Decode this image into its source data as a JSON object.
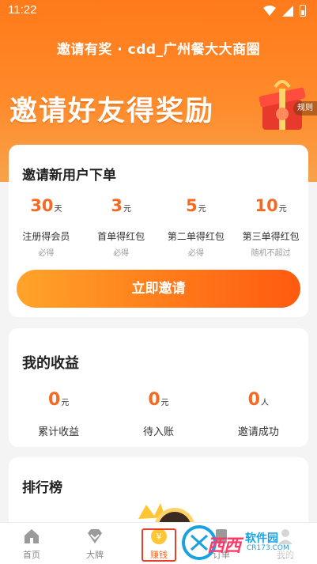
{
  "status_bar": {
    "time": "11:22"
  },
  "header": {
    "title": "邀请有奖 · cdd_广州餐大大商圈",
    "headline": "邀请好友得奖励",
    "rules_label": "规则"
  },
  "invite_card": {
    "title": "邀请新用户下单",
    "rewards": [
      {
        "amount": "30",
        "unit": "天",
        "name": "注册得会员",
        "note": "必得"
      },
      {
        "amount": "3",
        "unit": "元",
        "name": "首单得红包",
        "note": "必得"
      },
      {
        "amount": "5",
        "unit": "元",
        "name": "第二单得红包",
        "note": "必得"
      },
      {
        "amount": "10",
        "unit": "元",
        "name": "第三单得红包",
        "note": "随机不超过"
      }
    ],
    "button_label": "立即邀请"
  },
  "earnings_card": {
    "title": "我的收益",
    "items": [
      {
        "amount": "0",
        "unit": "元",
        "name": "累计收益"
      },
      {
        "amount": "0",
        "unit": "元",
        "name": "待入账"
      },
      {
        "amount": "0",
        "unit": "人",
        "name": "邀请成功"
      }
    ]
  },
  "ranking_card": {
    "title": "排行榜"
  },
  "tabbar": {
    "items": [
      {
        "label": "首页",
        "icon": "home-icon"
      },
      {
        "label": "大牌",
        "icon": "diamond-icon"
      },
      {
        "label": "赚钱",
        "icon": "coin-icon"
      },
      {
        "label": "订单",
        "icon": "order-icon"
      },
      {
        "label": "我的",
        "icon": "user-icon"
      }
    ]
  },
  "watermark": {
    "text": "西西",
    "brand": "软件园",
    "url": "CR173.COM"
  },
  "colors": {
    "accent": "#f56a22",
    "hero": "#ff7a1a"
  }
}
